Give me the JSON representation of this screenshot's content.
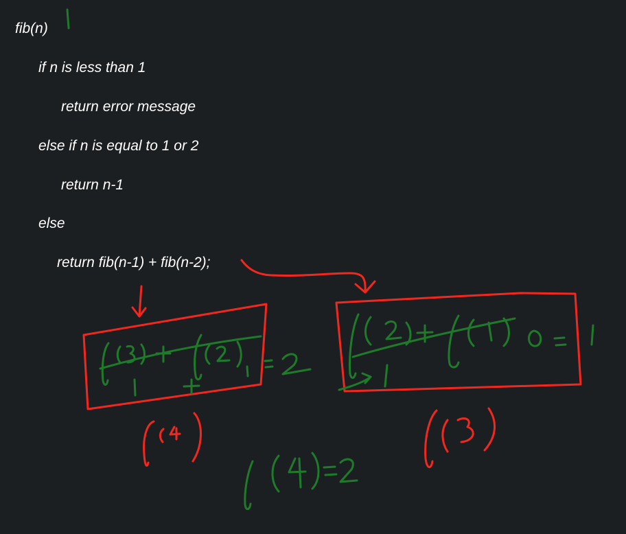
{
  "code": {
    "lines": [
      "fib(n)",
      "if n is less than 1",
      "return error message",
      "else if n is equal to 1 or 2",
      "return n-1",
      "else",
      "return fib(n-1) + fib(n-2);"
    ]
  },
  "colors": {
    "background": "#1c1f21",
    "code_text": "#ffffff",
    "red_ink": "#f2281e",
    "green_ink": "#1e7b2a"
  }
}
